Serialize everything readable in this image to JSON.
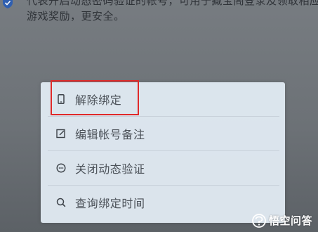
{
  "info": {
    "line1": "代表开启动态密码验证的帐号，可用于藏宝阁登录及领取相应",
    "line2": "游戏奖励，更安全。",
    "icon": "shield-check-icon"
  },
  "menu": {
    "items": [
      {
        "label": "解除绑定",
        "icon": "phone-icon"
      },
      {
        "label": "编辑帐号备注",
        "icon": "edit-icon"
      },
      {
        "label": "关闭动态验证",
        "icon": "dynamic-verify-icon"
      },
      {
        "label": "查询绑定时间",
        "icon": "search-icon"
      }
    ]
  },
  "annotation": {
    "highlight_color": "#e02a2a"
  },
  "watermark": {
    "text": "悟空问答"
  },
  "colors": {
    "background": "#6f7479",
    "sheet": "#dfe8f1",
    "text": "#4b5158"
  }
}
